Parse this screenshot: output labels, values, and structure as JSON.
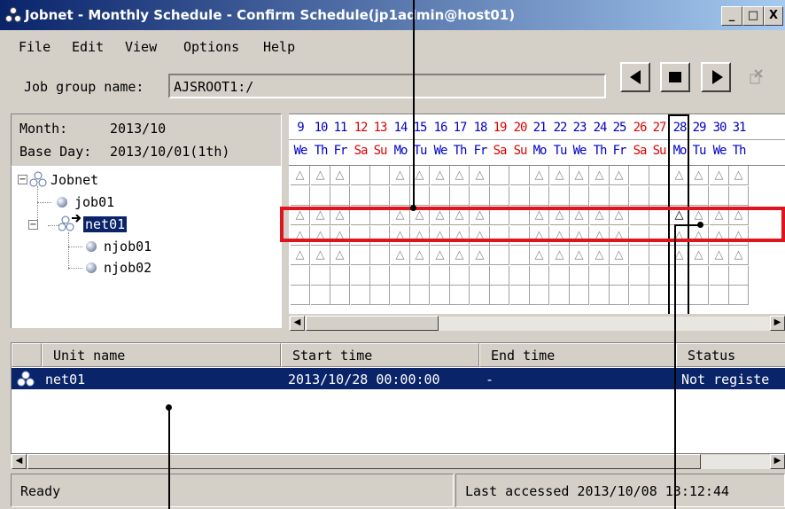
{
  "window": {
    "title": "Jobnet - Monthly Schedule - Confirm Schedule(jp1admin@host01)",
    "controls": [
      "_",
      "□",
      "X"
    ]
  },
  "menu": [
    "File",
    "Edit",
    "View",
    "Options",
    "Help"
  ],
  "toolbar": {
    "job_group_label": "Job group name:",
    "job_group_value": "AJSROOT1:/",
    "nav_buttons": [
      "previous-icon",
      "stop-icon",
      "next-icon",
      "disabled-action-icon"
    ]
  },
  "info": {
    "month_label": "Month:",
    "month_value": "2013/10",
    "base_day_label": "Base Day:",
    "base_day_value": "2013/10/01(1th)"
  },
  "tree": {
    "items": [
      {
        "label": "Jobnet",
        "icon": "jobnet-icon",
        "level": 0
      },
      {
        "label": "job01",
        "icon": "job-icon",
        "level": 1
      },
      {
        "label": "net01",
        "icon": "nested-jobnet-icon",
        "level": 1,
        "selected": true
      },
      {
        "label": "njob01",
        "icon": "job-icon",
        "level": 2
      },
      {
        "label": "njob02",
        "icon": "job-icon",
        "level": 2
      }
    ]
  },
  "calendar": {
    "days": [
      {
        "d": "9",
        "w": "We",
        "color": "#0000c8"
      },
      {
        "d": "10",
        "w": "Th",
        "color": "#0000c8"
      },
      {
        "d": "11",
        "w": "Fr",
        "color": "#0000c8"
      },
      {
        "d": "12",
        "w": "Sa",
        "color": "#e00000"
      },
      {
        "d": "13",
        "w": "Su",
        "color": "#e00000"
      },
      {
        "d": "14",
        "w": "Mo",
        "color": "#0000c8"
      },
      {
        "d": "15",
        "w": "Tu",
        "color": "#0000c8"
      },
      {
        "d": "16",
        "w": "We",
        "color": "#0000c8"
      },
      {
        "d": "17",
        "w": "Th",
        "color": "#0000c8"
      },
      {
        "d": "18",
        "w": "Fr",
        "color": "#0000c8"
      },
      {
        "d": "19",
        "w": "Sa",
        "color": "#e00000"
      },
      {
        "d": "20",
        "w": "Su",
        "color": "#e00000"
      },
      {
        "d": "21",
        "w": "Mo",
        "color": "#0000c8"
      },
      {
        "d": "22",
        "w": "Tu",
        "color": "#0000c8"
      },
      {
        "d": "23",
        "w": "We",
        "color": "#0000c8"
      },
      {
        "d": "24",
        "w": "Th",
        "color": "#0000c8"
      },
      {
        "d": "25",
        "w": "Fr",
        "color": "#0000c8"
      },
      {
        "d": "26",
        "w": "Sa",
        "color": "#e00000"
      },
      {
        "d": "27",
        "w": "Su",
        "color": "#e00000"
      },
      {
        "d": "28",
        "w": "Mo",
        "color": "#0000c8"
      },
      {
        "d": "29",
        "w": "Tu",
        "color": "#0000c8"
      },
      {
        "d": "30",
        "w": "We",
        "color": "#0000c8"
      },
      {
        "d": "31",
        "w": "Th",
        "color": "#0000c8"
      }
    ],
    "mark": "△",
    "rows": [
      [
        1,
        1,
        1,
        0,
        0,
        1,
        1,
        1,
        1,
        1,
        0,
        0,
        1,
        1,
        1,
        1,
        1,
        0,
        0,
        1,
        1,
        1,
        1
      ],
      [
        0,
        0,
        0,
        0,
        0,
        0,
        0,
        0,
        0,
        0,
        0,
        0,
        0,
        0,
        0,
        0,
        0,
        0,
        0,
        0,
        0,
        0,
        0
      ],
      [
        1,
        1,
        1,
        0,
        0,
        1,
        1,
        1,
        1,
        1,
        0,
        0,
        1,
        1,
        1,
        1,
        1,
        0,
        0,
        2,
        1,
        1,
        1
      ],
      [
        1,
        1,
        1,
        0,
        0,
        1,
        1,
        1,
        1,
        1,
        0,
        0,
        1,
        1,
        1,
        1,
        1,
        0,
        0,
        1,
        1,
        1,
        1
      ],
      [
        1,
        1,
        1,
        0,
        0,
        1,
        1,
        1,
        1,
        1,
        0,
        0,
        1,
        1,
        1,
        1,
        1,
        0,
        0,
        1,
        1,
        1,
        1
      ],
      [
        0,
        0,
        0,
        0,
        0,
        0,
        0,
        0,
        0,
        0,
        0,
        0,
        0,
        0,
        0,
        0,
        0,
        0,
        0,
        0,
        0,
        0,
        0
      ],
      [
        0,
        0,
        0,
        0,
        0,
        0,
        0,
        0,
        0,
        0,
        0,
        0,
        0,
        0,
        0,
        0,
        0,
        0,
        0,
        0,
        0,
        0,
        0
      ]
    ],
    "highlight_day": "28"
  },
  "list": {
    "columns": [
      "Unit name",
      "Start time",
      "End time",
      "Status"
    ],
    "rows": [
      {
        "unit": "net01",
        "start": "2013/10/28 00:00:00",
        "end": "-",
        "status": "Not registe"
      }
    ]
  },
  "status": {
    "left": "Ready",
    "right": "Last accessed 2013/10/08 13:12:44"
  },
  "colors": {
    "selection": "#0a246a",
    "weekday": "#0000c8",
    "weekend": "#e00000",
    "highlight_box": "#e0141e"
  }
}
